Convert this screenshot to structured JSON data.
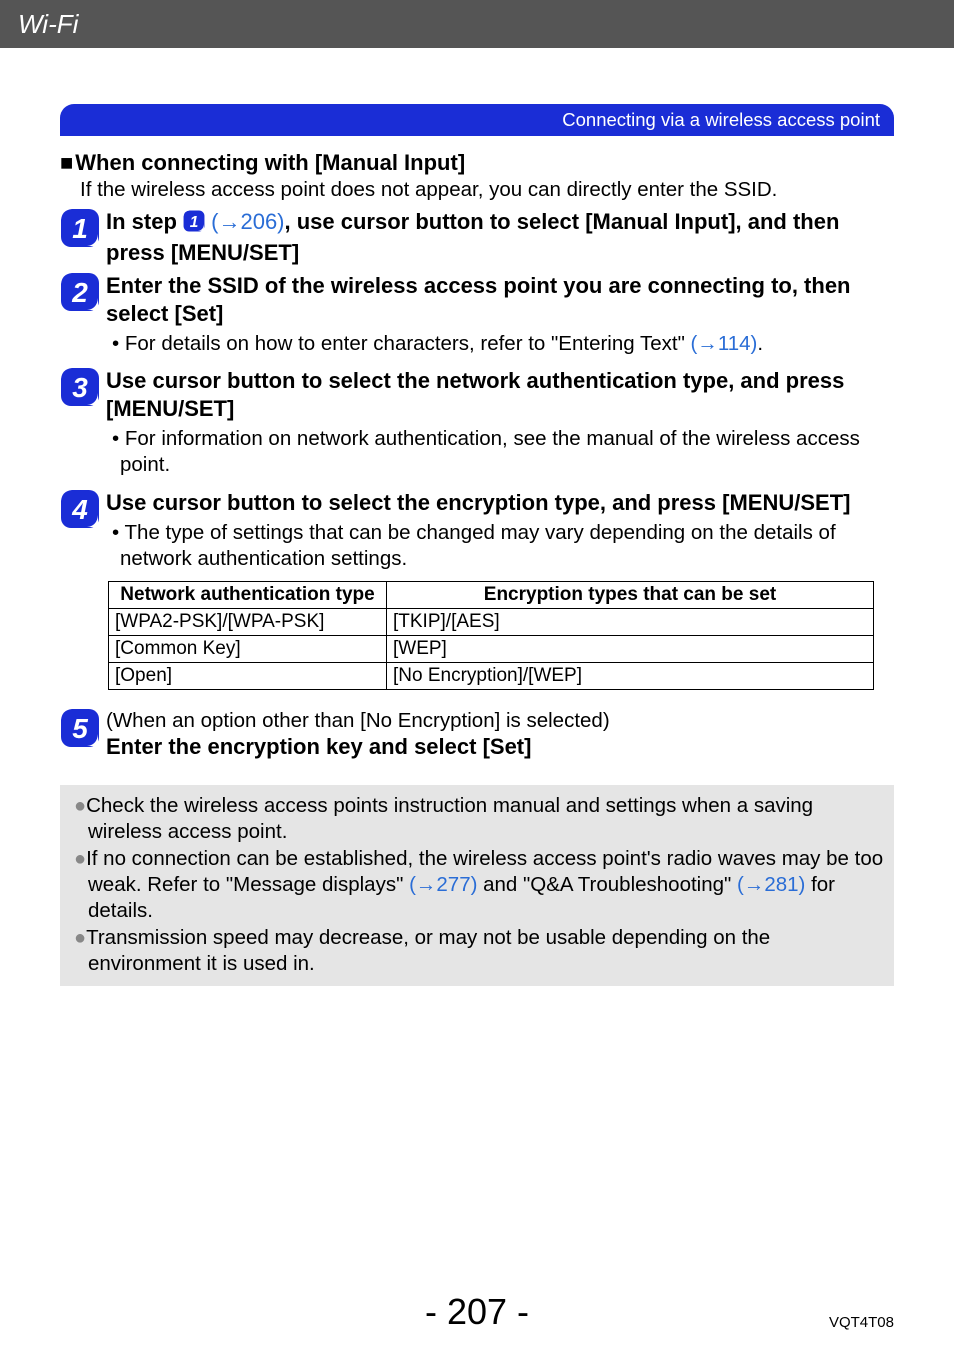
{
  "header": {
    "title": "Wi-Fi"
  },
  "banner": {
    "text": "Connecting via a wireless access point"
  },
  "section": {
    "heading": "When connecting with [Manual Input]",
    "intro": "If the wireless access point does not appear, you can directly enter the SSID."
  },
  "steps": {
    "s1": {
      "pre": "In step ",
      "link": "(→206)",
      "post": ", use cursor button to select [Manual Input], and then press [MENU/SET]"
    },
    "s2": {
      "title": "Enter the SSID of the wireless access point you are connecting to, then select [Set]",
      "bullet_pre": "For details on how to enter characters, refer to \"Entering Text\" ",
      "bullet_link": "(→114)",
      "bullet_post": "."
    },
    "s3": {
      "title": "Use cursor button to select the network authentication type, and press [MENU/SET]",
      "bullet": "For information on network authentication, see the manual of the wireless access point."
    },
    "s4": {
      "title": "Use cursor button to select the encryption type, and press [MENU/SET]",
      "bullet": "The type of settings that can be changed may vary depending on the details of network authentication settings."
    },
    "s5": {
      "paren": "(When an option other than [No Encryption] is selected)",
      "title": "Enter the encryption key and select [Set]"
    }
  },
  "table": {
    "headers": {
      "col1": "Network authentication type",
      "col2": "Encryption types that can be set"
    },
    "rows": [
      {
        "c1": "[WPA2-PSK]/[WPA-PSK]",
        "c2": "[TKIP]/[AES]"
      },
      {
        "c1": "[Common Key]",
        "c2": "[WEP]"
      },
      {
        "c1": "[Open]",
        "c2": "[No Encryption]/[WEP]"
      }
    ]
  },
  "greybox": {
    "i1": "Check the wireless access points instruction manual and settings when a saving wireless access point.",
    "i2_pre": "If no connection can be established, the wireless access point's radio waves may be too weak. Refer to \"Message displays\" ",
    "i2_link1": "(→277)",
    "i2_mid": " and \"Q&A Troubleshooting\" ",
    "i2_link2": "(→281)",
    "i2_post": " for details.",
    "i3": "Transmission speed may decrease, or may not be usable depending on the environment it is used in."
  },
  "footer": {
    "page": "- 207 -",
    "code": "VQT4T08"
  }
}
